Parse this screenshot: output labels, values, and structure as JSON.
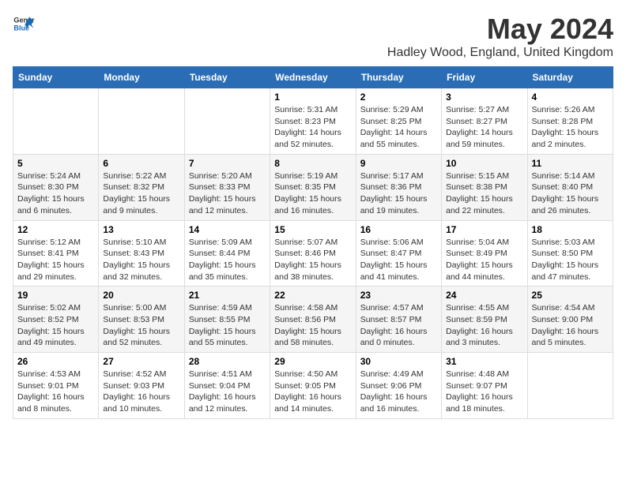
{
  "header": {
    "logo_general": "General",
    "logo_blue": "Blue",
    "title": "May 2024",
    "subtitle": "Hadley Wood, England, United Kingdom"
  },
  "days_of_week": [
    "Sunday",
    "Monday",
    "Tuesday",
    "Wednesday",
    "Thursday",
    "Friday",
    "Saturday"
  ],
  "weeks": [
    [
      {
        "day": "",
        "info": ""
      },
      {
        "day": "",
        "info": ""
      },
      {
        "day": "",
        "info": ""
      },
      {
        "day": "1",
        "info": "Sunrise: 5:31 AM\nSunset: 8:23 PM\nDaylight: 14 hours\nand 52 minutes."
      },
      {
        "day": "2",
        "info": "Sunrise: 5:29 AM\nSunset: 8:25 PM\nDaylight: 14 hours\nand 55 minutes."
      },
      {
        "day": "3",
        "info": "Sunrise: 5:27 AM\nSunset: 8:27 PM\nDaylight: 14 hours\nand 59 minutes."
      },
      {
        "day": "4",
        "info": "Sunrise: 5:26 AM\nSunset: 8:28 PM\nDaylight: 15 hours\nand 2 minutes."
      }
    ],
    [
      {
        "day": "5",
        "info": "Sunrise: 5:24 AM\nSunset: 8:30 PM\nDaylight: 15 hours\nand 6 minutes."
      },
      {
        "day": "6",
        "info": "Sunrise: 5:22 AM\nSunset: 8:32 PM\nDaylight: 15 hours\nand 9 minutes."
      },
      {
        "day": "7",
        "info": "Sunrise: 5:20 AM\nSunset: 8:33 PM\nDaylight: 15 hours\nand 12 minutes."
      },
      {
        "day": "8",
        "info": "Sunrise: 5:19 AM\nSunset: 8:35 PM\nDaylight: 15 hours\nand 16 minutes."
      },
      {
        "day": "9",
        "info": "Sunrise: 5:17 AM\nSunset: 8:36 PM\nDaylight: 15 hours\nand 19 minutes."
      },
      {
        "day": "10",
        "info": "Sunrise: 5:15 AM\nSunset: 8:38 PM\nDaylight: 15 hours\nand 22 minutes."
      },
      {
        "day": "11",
        "info": "Sunrise: 5:14 AM\nSunset: 8:40 PM\nDaylight: 15 hours\nand 26 minutes."
      }
    ],
    [
      {
        "day": "12",
        "info": "Sunrise: 5:12 AM\nSunset: 8:41 PM\nDaylight: 15 hours\nand 29 minutes."
      },
      {
        "day": "13",
        "info": "Sunrise: 5:10 AM\nSunset: 8:43 PM\nDaylight: 15 hours\nand 32 minutes."
      },
      {
        "day": "14",
        "info": "Sunrise: 5:09 AM\nSunset: 8:44 PM\nDaylight: 15 hours\nand 35 minutes."
      },
      {
        "day": "15",
        "info": "Sunrise: 5:07 AM\nSunset: 8:46 PM\nDaylight: 15 hours\nand 38 minutes."
      },
      {
        "day": "16",
        "info": "Sunrise: 5:06 AM\nSunset: 8:47 PM\nDaylight: 15 hours\nand 41 minutes."
      },
      {
        "day": "17",
        "info": "Sunrise: 5:04 AM\nSunset: 8:49 PM\nDaylight: 15 hours\nand 44 minutes."
      },
      {
        "day": "18",
        "info": "Sunrise: 5:03 AM\nSunset: 8:50 PM\nDaylight: 15 hours\nand 47 minutes."
      }
    ],
    [
      {
        "day": "19",
        "info": "Sunrise: 5:02 AM\nSunset: 8:52 PM\nDaylight: 15 hours\nand 49 minutes."
      },
      {
        "day": "20",
        "info": "Sunrise: 5:00 AM\nSunset: 8:53 PM\nDaylight: 15 hours\nand 52 minutes."
      },
      {
        "day": "21",
        "info": "Sunrise: 4:59 AM\nSunset: 8:55 PM\nDaylight: 15 hours\nand 55 minutes."
      },
      {
        "day": "22",
        "info": "Sunrise: 4:58 AM\nSunset: 8:56 PM\nDaylight: 15 hours\nand 58 minutes."
      },
      {
        "day": "23",
        "info": "Sunrise: 4:57 AM\nSunset: 8:57 PM\nDaylight: 16 hours\nand 0 minutes."
      },
      {
        "day": "24",
        "info": "Sunrise: 4:55 AM\nSunset: 8:59 PM\nDaylight: 16 hours\nand 3 minutes."
      },
      {
        "day": "25",
        "info": "Sunrise: 4:54 AM\nSunset: 9:00 PM\nDaylight: 16 hours\nand 5 minutes."
      }
    ],
    [
      {
        "day": "26",
        "info": "Sunrise: 4:53 AM\nSunset: 9:01 PM\nDaylight: 16 hours\nand 8 minutes."
      },
      {
        "day": "27",
        "info": "Sunrise: 4:52 AM\nSunset: 9:03 PM\nDaylight: 16 hours\nand 10 minutes."
      },
      {
        "day": "28",
        "info": "Sunrise: 4:51 AM\nSunset: 9:04 PM\nDaylight: 16 hours\nand 12 minutes."
      },
      {
        "day": "29",
        "info": "Sunrise: 4:50 AM\nSunset: 9:05 PM\nDaylight: 16 hours\nand 14 minutes."
      },
      {
        "day": "30",
        "info": "Sunrise: 4:49 AM\nSunset: 9:06 PM\nDaylight: 16 hours\nand 16 minutes."
      },
      {
        "day": "31",
        "info": "Sunrise: 4:48 AM\nSunset: 9:07 PM\nDaylight: 16 hours\nand 18 minutes."
      },
      {
        "day": "",
        "info": ""
      }
    ]
  ]
}
